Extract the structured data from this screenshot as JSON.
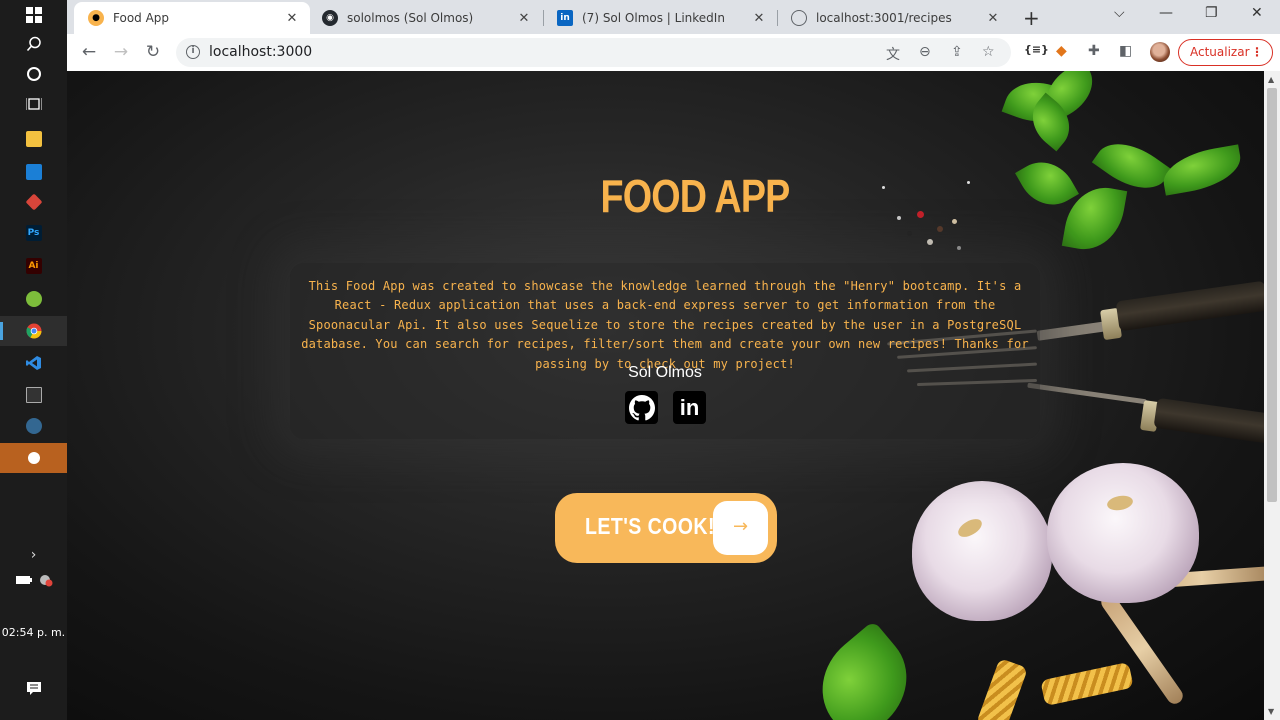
{
  "taskbar": {
    "clock": "02:54 p. m.",
    "items": [
      {
        "name": "windows-start",
        "icon": "windows-logo-icon"
      },
      {
        "name": "search",
        "icon": "search-icon"
      },
      {
        "name": "cortana",
        "icon": "cortana-circle-icon"
      },
      {
        "name": "task-view",
        "icon": "task-view-icon"
      },
      {
        "name": "file-explorer",
        "icon": "folder-icon"
      },
      {
        "name": "mail",
        "icon": "mail-icon"
      },
      {
        "name": "app-red",
        "icon": "app-icon"
      },
      {
        "name": "photoshop",
        "icon": "photoshop-icon",
        "label": "Ps"
      },
      {
        "name": "illustrator",
        "icon": "illustrator-icon",
        "label": "Ai"
      },
      {
        "name": "app-green",
        "icon": "app-icon"
      },
      {
        "name": "chrome",
        "icon": "chrome-icon"
      },
      {
        "name": "vscode",
        "icon": "vscode-icon"
      },
      {
        "name": "terminal",
        "icon": "terminal-icon"
      },
      {
        "name": "postgres",
        "icon": "postgres-icon"
      },
      {
        "name": "app-orange",
        "icon": "app-icon"
      }
    ]
  },
  "browser": {
    "tabs": [
      {
        "title": "Food App",
        "active": true,
        "favicon": "food-app-icon"
      },
      {
        "title": "sololmos (Sol Olmos)",
        "active": false,
        "favicon": "github-icon"
      },
      {
        "title": "(7) Sol Olmos | LinkedIn",
        "active": false,
        "favicon": "linkedin-icon"
      },
      {
        "title": "localhost:3001/recipes",
        "active": false,
        "favicon": "globe-icon"
      }
    ],
    "url": "localhost:3000",
    "update_button": "Actualizar"
  },
  "page": {
    "title": "FOOD APP",
    "description": "This Food App was created to showcase the knowledge learned through the \"Henry\" bootcamp. It's a React - Redux application that uses a back-end express server to get information from the Spoonacular Api. It also uses Sequelize to store the recipes created by the user in a PostgreSQL database. You can search for recipes, filter/sort them and create your own new recipes! Thanks for passing by to check out my project!",
    "author": "Sol Olmos",
    "social": [
      {
        "name": "github",
        "icon": "github-icon"
      },
      {
        "name": "linkedin",
        "icon": "linkedin-icon",
        "label": "in"
      }
    ],
    "cta_label": "LET'S COOK!",
    "cta_arrow": "→"
  },
  "colors": {
    "accent": "#f8b34d",
    "cta_bg": "#f8b85a",
    "update_red": "#d93025"
  }
}
